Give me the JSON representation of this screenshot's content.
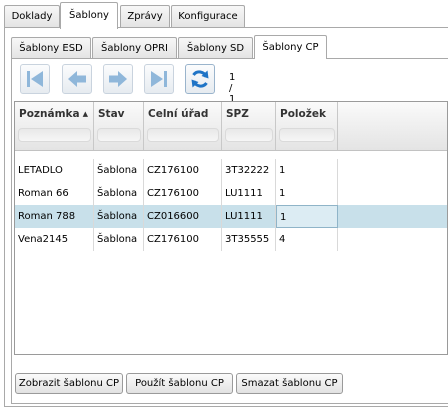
{
  "top_tabs": [
    {
      "label": "Doklady",
      "active": false
    },
    {
      "label": "Šablony",
      "active": true
    },
    {
      "label": "Zprávy",
      "active": false
    },
    {
      "label": "Konfigurace",
      "active": false
    }
  ],
  "sub_tabs": [
    {
      "label": "Šablony ESD",
      "active": false
    },
    {
      "label": "Šablony OPRI",
      "active": false
    },
    {
      "label": "Šablony SD",
      "active": false
    },
    {
      "label": "Šablony CP",
      "active": true
    }
  ],
  "toolbar": {
    "first_icon": "first-page-icon",
    "prev_icon": "prev-page-icon",
    "next_icon": "next-page-icon",
    "last_icon": "last-page-icon",
    "refresh_icon": "refresh-icon",
    "pager_text": "1 / 1"
  },
  "grid": {
    "columns": [
      "Poznámka",
      "Stav",
      "Celní úřad",
      "SPZ",
      "Položek"
    ],
    "sorted_column": "Poznámka",
    "sort_direction": "ascending",
    "rows": [
      [
        "LETADLO",
        "Šablona",
        "CZ176100",
        "3T32222",
        "1"
      ],
      [
        "Roman 66",
        "Šablona",
        "CZ176100",
        "LU1111",
        "1"
      ],
      [
        "Roman 788",
        "Šablona",
        "CZ016600",
        "LU1111",
        "1"
      ],
      [
        "Vena2145",
        "Šablona",
        "CZ176100",
        "3T35555",
        "4"
      ]
    ],
    "selected_row": 2
  },
  "buttons": {
    "show": "Zobrazit šablonu CP",
    "use": "Použít šablonu CP",
    "delete": "Smazat šablonu CP"
  },
  "colors": {
    "selected_row": "#c8e0ea",
    "nav_icon_disabled": "#8fb7da",
    "refresh_icon": "#1f74c6"
  }
}
